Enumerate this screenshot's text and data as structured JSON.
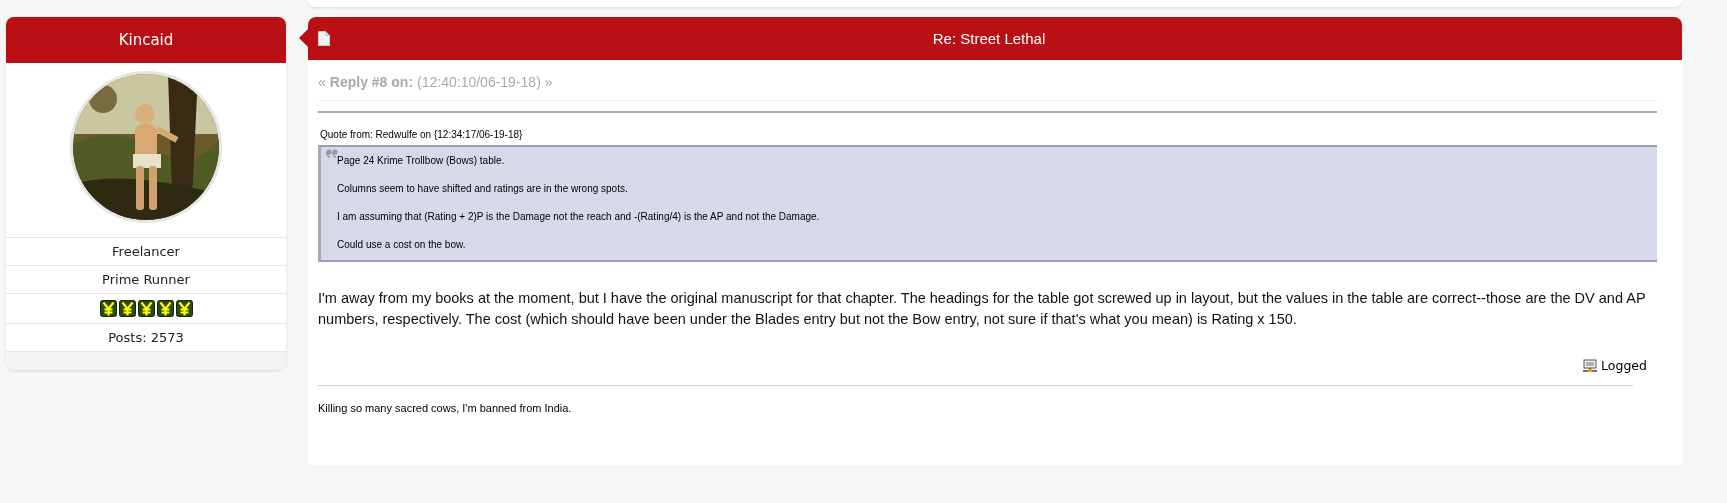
{
  "poster": {
    "name": "Kincaid",
    "details": [
      "Freelancer",
      "Prime Runner"
    ],
    "rank_icons": [
      {
        "kind": "yen"
      },
      {
        "kind": "yen"
      },
      {
        "kind": "yen"
      },
      {
        "kind": "yen"
      },
      {
        "kind": "yen"
      }
    ],
    "posts": "Posts: 2573"
  },
  "post": {
    "title": "Re: Street Lethal",
    "reply_prefix": "«",
    "reply_label": "Reply #8 on:",
    "reply_time": "(12:40:10/06-19-18)",
    "reply_suffix": "»",
    "quote": {
      "header": "Quote from: Redwulfe on {12:34:17/06-19-18}",
      "paragraphs": [
        "Page 24 Krime Trollbow (Bows) table.",
        "Columns seem to have shifted and ratings are in the wrong spots.",
        "I am assuming that (Rating + 2)P is the Damage not the reach and -(Rating/4) is the AP and not the Damage.",
        "Could use a cost on the bow."
      ]
    },
    "body": "I'm away from my books at the moment, but I have the original manuscript for that chapter.  The headings for the table got screwed up in layout, but the values in the table are correct--those are the DV and AP numbers, respectively.  The cost (which should have been under the Blades entry but not the Bow entry, not sure if that's what you mean) is Rating x 150.",
    "logged": "Logged",
    "signature": "Killing so many sacred cows, I'm banned from India."
  }
}
